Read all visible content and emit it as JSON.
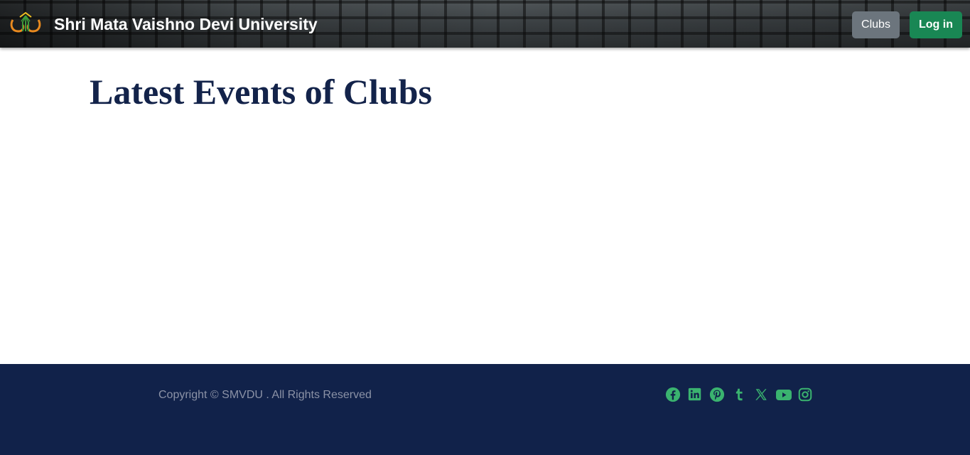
{
  "header": {
    "brand_name": "Shri Mata Vaishno Devi University",
    "nav_clubs_label": "Clubs",
    "login_label": "Log in"
  },
  "main": {
    "title": "Latest Events of Clubs"
  },
  "footer": {
    "copyright": "Copyright © SMVDU . All Rights Reserved",
    "social_icons": [
      "facebook-icon",
      "linkedin-icon",
      "pinterest-icon",
      "tumblr-icon",
      "x-icon",
      "youtube-icon",
      "instagram-icon"
    ]
  },
  "colors": {
    "title": "#13234a",
    "footer_bg": "#11224a",
    "clubs_button": "#6c757d",
    "login_button": "#198754",
    "social_icon": "#3ab36f"
  }
}
